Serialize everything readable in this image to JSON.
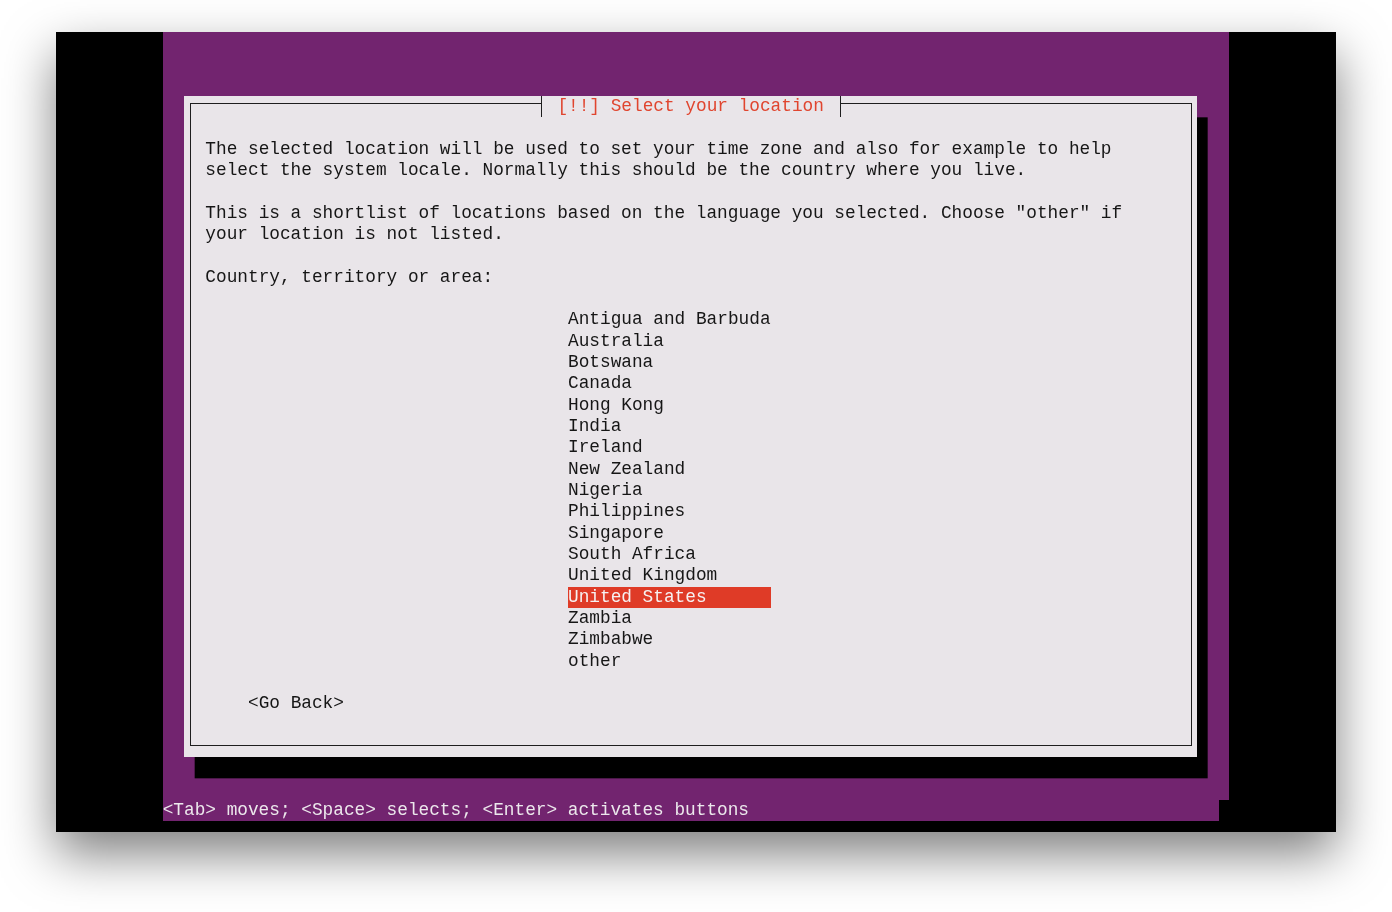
{
  "dialog": {
    "title": "[!!] Select your location",
    "paragraphs": [
      "The selected location will be used to set your time zone and also for example to help select the system locale. Normally this should be the country where you live.",
      "This is a shortlist of locations based on the language you selected. Choose \"other\" if your location is not listed."
    ],
    "field_label": "Country, territory or area:",
    "options": [
      {
        "label": "Antigua and Barbuda",
        "selected": false
      },
      {
        "label": "Australia",
        "selected": false
      },
      {
        "label": "Botswana",
        "selected": false
      },
      {
        "label": "Canada",
        "selected": false
      },
      {
        "label": "Hong Kong",
        "selected": false
      },
      {
        "label": "India",
        "selected": false
      },
      {
        "label": "Ireland",
        "selected": false
      },
      {
        "label": "New Zealand",
        "selected": false
      },
      {
        "label": "Nigeria",
        "selected": false
      },
      {
        "label": "Philippines",
        "selected": false
      },
      {
        "label": "Singapore",
        "selected": false
      },
      {
        "label": "South Africa",
        "selected": false
      },
      {
        "label": "United Kingdom",
        "selected": false
      },
      {
        "label": "United States",
        "selected": true
      },
      {
        "label": "Zambia",
        "selected": false
      },
      {
        "label": "Zimbabwe",
        "selected": false
      },
      {
        "label": "other",
        "selected": false
      }
    ],
    "buttons": [
      "<Go Back>"
    ]
  },
  "status_bar": "<Tab> moves; <Space> selects; <Enter> activates buttons"
}
